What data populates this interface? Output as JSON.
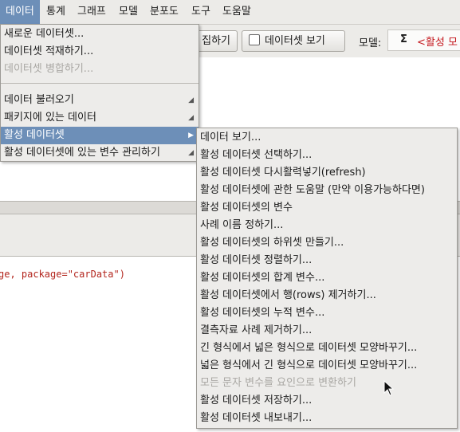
{
  "menubar": {
    "items": [
      "데이터",
      "통계",
      "그래프",
      "모델",
      "분포도",
      "도구",
      "도움말"
    ]
  },
  "toolbar": {
    "edit_button": "집하기",
    "view_button": "데이터셋 보기",
    "model_label": "모델:",
    "model_sigma": "Σ",
    "model_value": "<활성 모"
  },
  "console": {
    "code": "ge, package=\"carData\")"
  },
  "data_menu": {
    "items": [
      {
        "label": "새로운 데이터셋..."
      },
      {
        "label": "데이터셋 적재하기..."
      },
      {
        "label": "데이터셋 병합하기..."
      },
      {
        "label": "데이터 불러오기"
      },
      {
        "label": "패키지에 있는 데이터"
      },
      {
        "label": "활성 데이터셋"
      },
      {
        "label": "활성 데이터셋에 있는 변수 관리하기"
      }
    ]
  },
  "active_dataset_menu": {
    "items": [
      {
        "label": "데이터 보기..."
      },
      {
        "label": "활성 데이터셋 선택하기..."
      },
      {
        "label": "활성 데이터셋 다시활력넣기(refresh)"
      },
      {
        "label": "활성 데이터셋에 관한 도움말 (만약 이용가능하다면)"
      },
      {
        "label": "활성 데이터셋의 변수"
      },
      {
        "label": "사례 이름 정하기..."
      },
      {
        "label": "활성 데이터셋의 하위셋 만들기..."
      },
      {
        "label": "활성 데이터셋 정렬하기..."
      },
      {
        "label": "활성 데이터셋의 합계 변수..."
      },
      {
        "label": "활성 데이터셋에서 행(rows) 제거하기..."
      },
      {
        "label": "활성 데이터셋의 누적 변수..."
      },
      {
        "label": "결측자료 사례 제거하기..."
      },
      {
        "label": "긴 형식에서 넓은 형식으로 데이터셋 모양바꾸기..."
      },
      {
        "label": "넓은 형식에서 긴 형식으로 데이터셋 모양바꾸기..."
      },
      {
        "label": "모든 문자 변수를 요인으로 변환하기"
      },
      {
        "label": "활성 데이터셋 저장하기..."
      },
      {
        "label": "활성 데이터셋 내보내기..."
      }
    ]
  }
}
